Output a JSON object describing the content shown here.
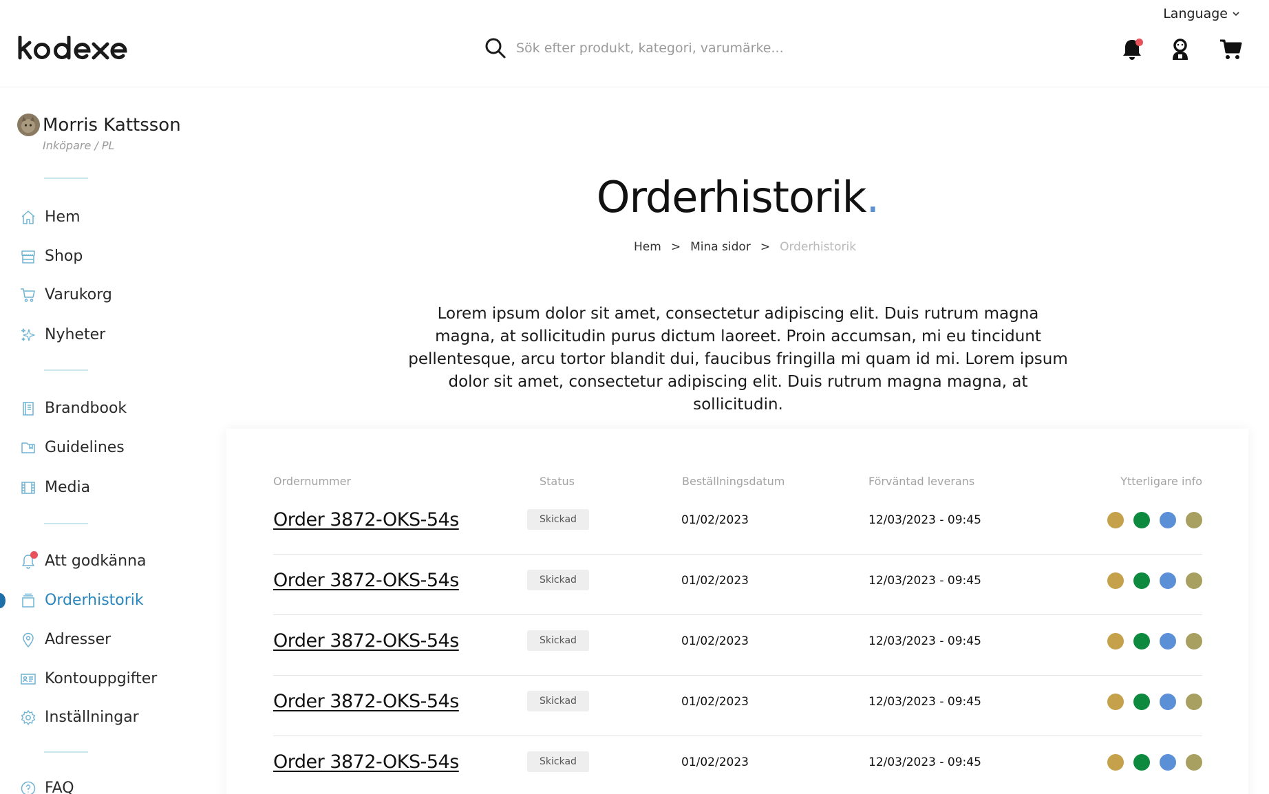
{
  "header": {
    "language_label": "Language",
    "search_placeholder": "Sök efter produkt, kategori, varumärke..."
  },
  "profile": {
    "name": "Morris Kattsson",
    "role": "Inköpare / PL"
  },
  "sidebar": {
    "items": [
      {
        "label": "Hem",
        "icon": "home-icon"
      },
      {
        "label": "Shop",
        "icon": "store-icon"
      },
      {
        "label": "Varukorg",
        "icon": "cart-icon"
      },
      {
        "label": "Nyheter",
        "icon": "sparkle-icon"
      },
      {
        "label": "Brandbook",
        "icon": "book-icon"
      },
      {
        "label": "Guidelines",
        "icon": "folder-icon"
      },
      {
        "label": "Media",
        "icon": "film-icon"
      },
      {
        "label": "Att godkänna",
        "icon": "bell-icon"
      },
      {
        "label": "Orderhistorik",
        "icon": "box-icon",
        "active": true
      },
      {
        "label": "Adresser",
        "icon": "location-pin-icon"
      },
      {
        "label": "Kontouppgifter",
        "icon": "id-card-icon"
      },
      {
        "label": "Inställningar",
        "icon": "gear-icon"
      },
      {
        "label": "FAQ",
        "icon": "question-icon"
      }
    ]
  },
  "page": {
    "title": "Orderhistorik",
    "title_dot": ".",
    "breadcrumb": [
      "Hem",
      "Mina sidor",
      "Orderhistorik"
    ],
    "breadcrumb_sep": ">",
    "intro": "Lorem ipsum dolor sit amet, consectetur adipiscing elit. Duis rutrum magna magna, at sollicitudin purus dictum laoreet. Proin accumsan, mi eu tincidunt pellentesque, arcu tortor blandit dui, faucibus fringilla mi quam id mi. Lorem ipsum dolor sit amet, consectetur adipiscing elit. Duis rutrum magna magna, at sollicitudin."
  },
  "table": {
    "columns": [
      "Ordernummer",
      "Status",
      "Beställningsdatum",
      "Förväntad leverans",
      "Ytterligare info"
    ],
    "rows": [
      {
        "order": "Order 3872-OKS-54s",
        "status": "Skickad",
        "date": "01/02/2023",
        "delivery": "12/03/2023 - 09:45"
      },
      {
        "order": "Order 3872-OKS-54s",
        "status": "Skickad",
        "date": "01/02/2023",
        "delivery": "12/03/2023 - 09:45"
      },
      {
        "order": "Order 3872-OKS-54s",
        "status": "Skickad",
        "date": "01/02/2023",
        "delivery": "12/03/2023 - 09:45"
      },
      {
        "order": "Order 3872-OKS-54s",
        "status": "Skickad",
        "date": "01/02/2023",
        "delivery": "12/03/2023 - 09:45"
      },
      {
        "order": "Order 3872-OKS-54s",
        "status": "Skickad",
        "date": "01/02/2023",
        "delivery": "12/03/2023 - 09:45"
      }
    ],
    "info_colors": [
      "#c4a14a",
      "#0e8a3e",
      "#5b8fd6",
      "#a8a060"
    ]
  },
  "colors": {
    "accent": "#2a86bd",
    "notification": "#e8525a",
    "divider": "#c9e6ee"
  }
}
